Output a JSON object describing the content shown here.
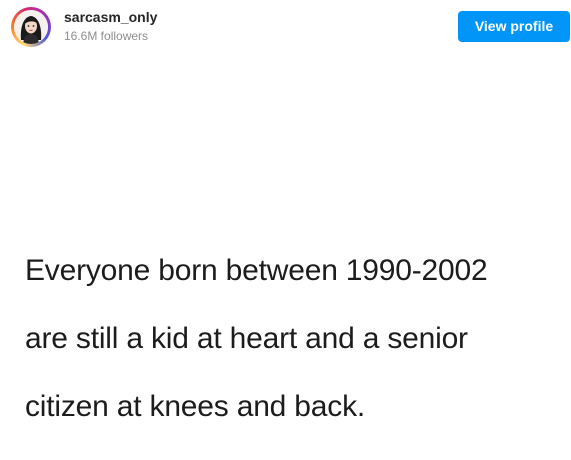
{
  "header": {
    "username": "sarcasm_only",
    "followers": "16.6M followers",
    "view_profile_label": "View profile",
    "avatar_icon": "woman-portrait-avatar",
    "button_color": "#0095f6"
  },
  "post": {
    "lines": [
      "Everyone born between 1990-2002",
      "are still a kid at heart and a senior",
      "citizen at knees and back."
    ],
    "background": "#ffffff"
  }
}
